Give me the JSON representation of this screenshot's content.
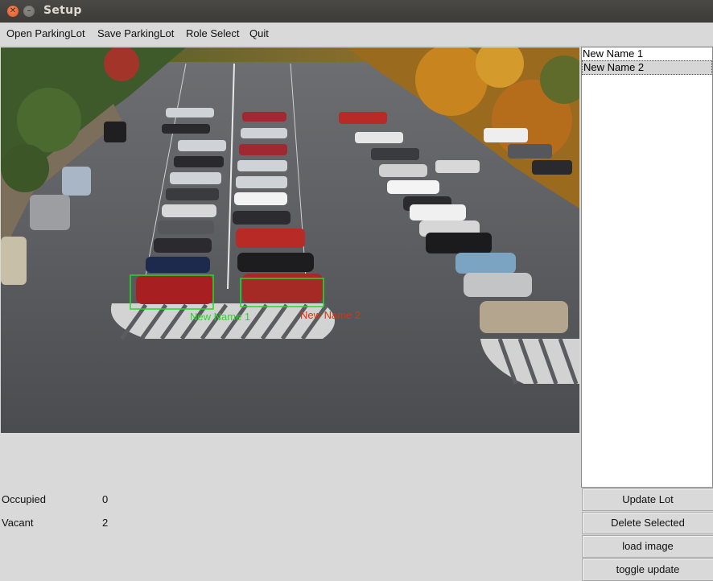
{
  "window": {
    "title": "Setup"
  },
  "menu": [
    "Open ParkingLot",
    "Save ParkingLot",
    "Role Select",
    "Quit"
  ],
  "spots": [
    {
      "name": "New Name 1",
      "label_color": "#22dd22"
    },
    {
      "name": "New Name 2",
      "label_color": "#e03010"
    }
  ],
  "list": {
    "items": [
      "New Name 1",
      "New Name 2"
    ],
    "selected_index": 1
  },
  "buttons": {
    "update_lot": "Update Lot",
    "delete_selected": "Delete Selected",
    "load_image": "load image",
    "toggle_update": "toggle update"
  },
  "stats": {
    "occupied_label": "Occupied",
    "occupied_value": "0",
    "vacant_label": "Vacant",
    "vacant_value": "2"
  },
  "colors": {
    "box": "#22dd22",
    "accent_close": "#e2511f"
  }
}
